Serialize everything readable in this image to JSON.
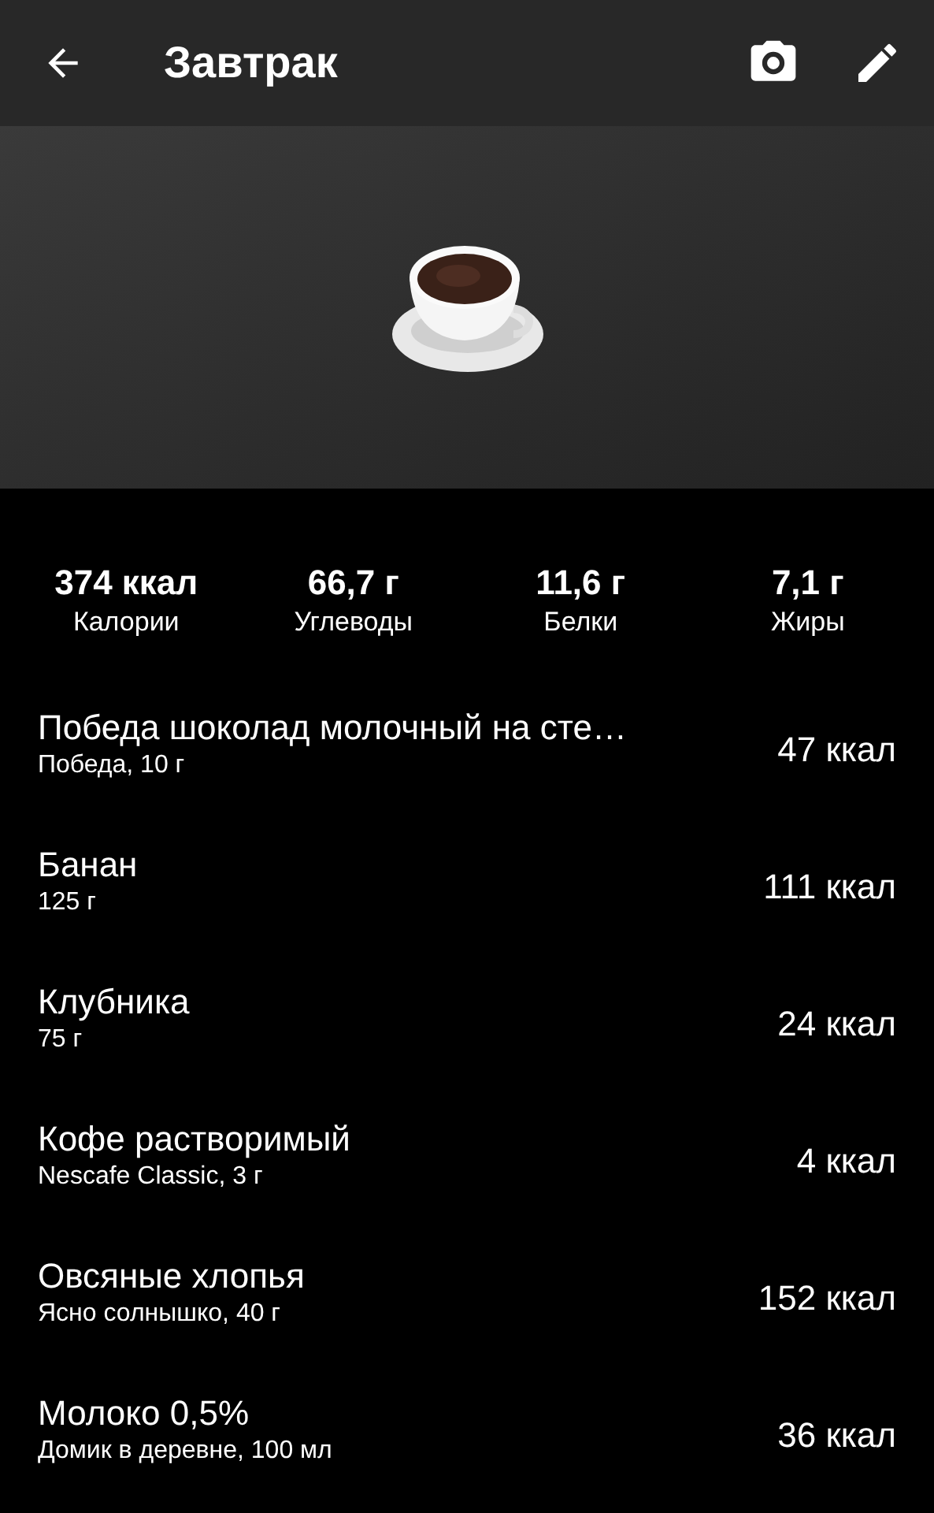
{
  "app_bar": {
    "title": "Завтрак"
  },
  "summary": [
    {
      "value": "374 ккал",
      "label": "Калории"
    },
    {
      "value": "66,7 г",
      "label": "Углеводы"
    },
    {
      "value": "11,6 г",
      "label": "Белки"
    },
    {
      "value": "7,1 г",
      "label": "Жиры"
    }
  ],
  "items": [
    {
      "name": "Победа шоколад молочный на сте…",
      "detail": "Победа, 10 г",
      "calories": "47 ккал"
    },
    {
      "name": "Банан",
      "detail": "125 г",
      "calories": "111 ккал"
    },
    {
      "name": "Клубника",
      "detail": "75 г",
      "calories": "24 ккал"
    },
    {
      "name": "Кофе растворимый",
      "detail": "Nescafe Classic, 3 г",
      "calories": "4 ккал"
    },
    {
      "name": "Овсяные хлопья",
      "detail": "Ясно солнышко, 40 г",
      "calories": "152 ккал"
    },
    {
      "name": "Молоко 0,5%",
      "detail": "Домик в деревне, 100 мл",
      "calories": "36 ккал"
    }
  ]
}
